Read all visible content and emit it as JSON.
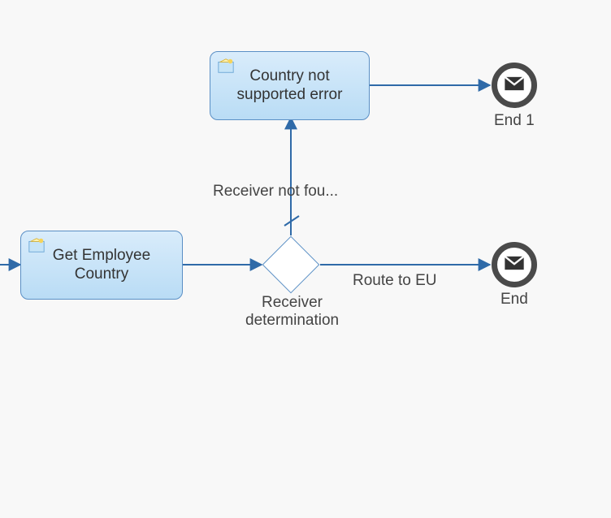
{
  "diagram": {
    "type": "bpmn-process-flow",
    "tasks": {
      "getEmployee": {
        "label": "Get Employee Country"
      },
      "countryError": {
        "label": "Country not supported error"
      }
    },
    "gateway": {
      "label": "Receiver determination"
    },
    "flows": {
      "notFound": {
        "label": "Receiver not fou..."
      },
      "routeEu": {
        "label": "Route to EU"
      }
    },
    "endEvents": {
      "end1": {
        "label": "End 1"
      },
      "end": {
        "label": "End"
      }
    }
  }
}
